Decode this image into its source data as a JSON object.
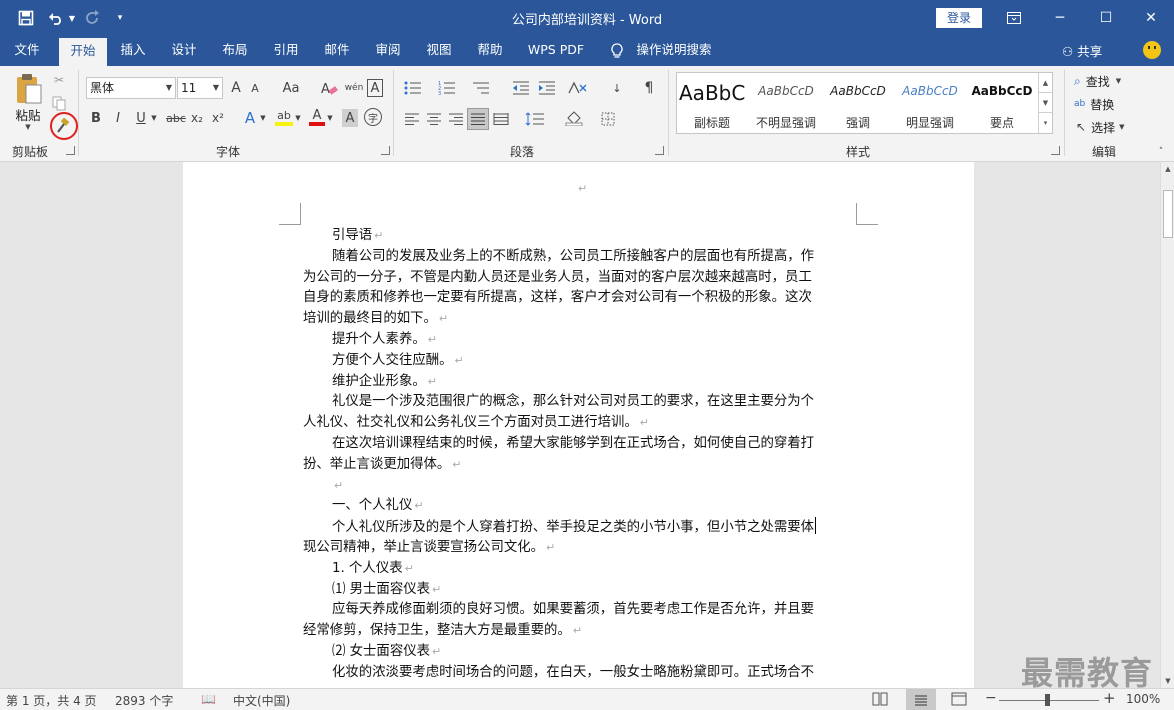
{
  "titlebar": {
    "document_title": "公司内部培训资料  -  Word",
    "login_label": "登录",
    "qat": {
      "save_icon": "save-icon",
      "undo_icon": "undo-icon",
      "redo_icon": "redo-icon",
      "customize_icon": "customize-qat-icon"
    },
    "window": {
      "ribbon_options_icon": "ribbon-display-options-icon",
      "minimize": "─",
      "maximize": "☐",
      "close": "✕"
    }
  },
  "tabs": [
    {
      "label": "文件"
    },
    {
      "label": "开始"
    },
    {
      "label": "插入"
    },
    {
      "label": "设计"
    },
    {
      "label": "布局"
    },
    {
      "label": "引用"
    },
    {
      "label": "邮件"
    },
    {
      "label": "审阅"
    },
    {
      "label": "视图"
    },
    {
      "label": "帮助"
    },
    {
      "label": "WPS PDF"
    },
    {
      "label": "操作说明搜索"
    }
  ],
  "active_tab": "开始",
  "share_label": "共享",
  "ribbon": {
    "clipboard": {
      "label": "剪贴板",
      "paste_label": "粘贴"
    },
    "font": {
      "label": "字体",
      "font_name": "黑体",
      "font_size": "11",
      "buttons": {
        "bold": "B",
        "italic": "I",
        "underline": "U",
        "strike": "abc",
        "sub": "x₂",
        "sup": "x²",
        "grow": "A",
        "shrink": "A",
        "case": "Aa",
        "pinyin": "wén",
        "border": "A",
        "effects": "A",
        "highlight": "ab",
        "color": "A",
        "shade": "A",
        "enclose": "字"
      }
    },
    "paragraph": {
      "label": "段落"
    },
    "styles": {
      "label": "样式",
      "items": [
        {
          "sample": "AaBbC",
          "name": "副标题"
        },
        {
          "sample": "AaBbCcD",
          "name": "不明显强调"
        },
        {
          "sample": "AaBbCcD",
          "name": "强调"
        },
        {
          "sample": "AaBbCcD",
          "name": "明显强调"
        },
        {
          "sample": "AaBbCcD",
          "name": "要点"
        }
      ]
    },
    "editing": {
      "label": "编辑",
      "find": "查找",
      "replace": "替换",
      "select": "选择"
    }
  },
  "document": {
    "paragraphs": [
      {
        "text": "引导语",
        "indent": true,
        "mark": "↵"
      },
      {
        "text": "随着公司的发展及业务上的不断成熟，公司员工所接触客户的层面也有所提高，作",
        "indent": true,
        "mark": ""
      },
      {
        "text": "为公司的一分子，不管是内勤人员还是业务人员，当面对的客户层次越来越高时，员工",
        "indent": false,
        "mark": ""
      },
      {
        "text": "自身的素质和修养也一定要有所提高，这样，客户才会对公司有一个积极的形象。这次",
        "indent": false,
        "mark": ""
      },
      {
        "text": "培训的最终目的如下。",
        "indent": false,
        "mark": "↵"
      },
      {
        "text": "提升个人素养。",
        "indent": true,
        "mark": "↵"
      },
      {
        "text": "方便个人交往应酬。",
        "indent": true,
        "mark": "↵"
      },
      {
        "text": "维护企业形象。",
        "indent": true,
        "mark": "↵"
      },
      {
        "text": "礼仪是一个涉及范围很广的概念，那么针对公司对员工的要求，在这里主要分为个",
        "indent": true,
        "mark": ""
      },
      {
        "text": "人礼仪、社交礼仪和公务礼仪三个方面对员工进行培训。",
        "indent": false,
        "mark": "↵"
      },
      {
        "text": "在这次培训课程结束的时候，希望大家能够学到在正式场合，如何使自己的穿着打",
        "indent": true,
        "mark": ""
      },
      {
        "text": "扮、举止言谈更加得体。",
        "indent": false,
        "mark": "↵"
      },
      {
        "text": "",
        "indent": true,
        "mark": "↵"
      },
      {
        "text": "一、个人礼仪",
        "indent": true,
        "mark": "↵"
      },
      {
        "text": "个人礼仪所涉及的是个人穿着打扮、举手投足之类的小节小事，但小节之处需要体",
        "indent": true,
        "mark": "",
        "cursor": true
      },
      {
        "text": "现公司精神，举止言谈要宣扬公司文化。",
        "indent": false,
        "mark": "↵"
      },
      {
        "text": "1.  个人仪表",
        "indent": true,
        "mark": "↵"
      },
      {
        "text": "⑴  男士面容仪表",
        "indent": true,
        "mark": "↵"
      },
      {
        "text": "应每天养成修面剃须的良好习惯。如果要蓄须，首先要考虑工作是否允许，并且要",
        "indent": true,
        "mark": ""
      },
      {
        "text": "经常修剪，保持卫生，整洁大方是最重要的。",
        "indent": false,
        "mark": "↵"
      },
      {
        "text": "⑵  女士面容仪表",
        "indent": true,
        "mark": "↵"
      },
      {
        "text": "化妆的浓淡要考虑时间场合的问题，在白天，一般女士略施粉黛即可。正式场合不",
        "indent": true,
        "mark": ""
      }
    ],
    "top_mark": "↵"
  },
  "watermark": "最需教育",
  "statusbar": {
    "page_info": "第 1 页，共 4 页",
    "word_count": "2893 个字",
    "language": "中文(中国)",
    "zoom_minus": "−",
    "zoom_plus": "+",
    "zoom": "100%"
  }
}
